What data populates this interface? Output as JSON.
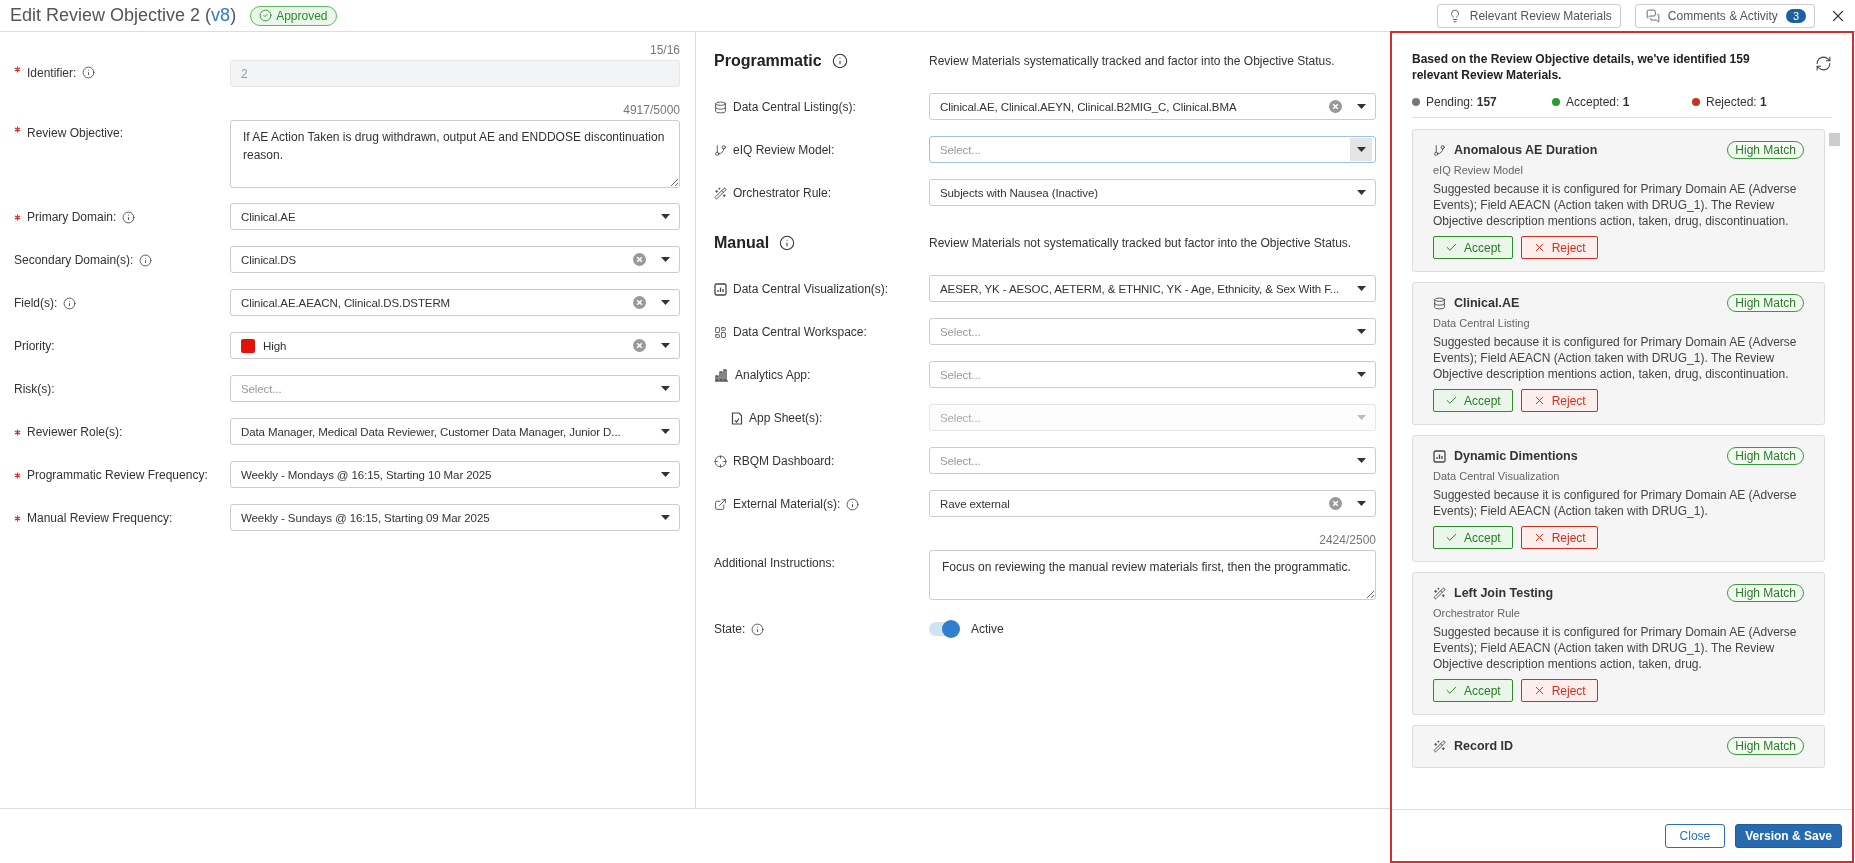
{
  "header": {
    "title": "Edit Review Objective 2",
    "version_open": "(",
    "version": "v8",
    "version_close": ")",
    "status": "Approved",
    "buttons": [
      {
        "kind": "materials",
        "label": "Relevant Review Materials"
      },
      {
        "kind": "comments",
        "label": "Comments & Activity",
        "count": "3"
      }
    ]
  },
  "left_form": {
    "fields": [
      {
        "label": "Identifier:",
        "required": true,
        "info": true,
        "kind": "input",
        "value": "2",
        "counter": "15/16",
        "disabled": true
      },
      {
        "label": "Review Objective:",
        "required": true,
        "info": false,
        "kind": "textarea",
        "value": "If AE Action Taken is drug withdrawn, output AE and ENDDOSE discontinuation reason.",
        "counter": "4917/5000",
        "disabled": false
      },
      {
        "label": "Primary Domain:",
        "required": true,
        "info": true,
        "kind": "select",
        "value": "Clinical.AE",
        "clearable": false,
        "disabled": false
      },
      {
        "label": "Secondary Domain(s):",
        "required": false,
        "info": true,
        "kind": "select",
        "value": "Clinical.DS",
        "clearable": true,
        "disabled": false
      },
      {
        "label": "Field(s):",
        "required": false,
        "info": true,
        "kind": "select",
        "value": "Clinical.AE.AEACN, Clinical.DS.DSTERM",
        "clearable": true,
        "disabled": false
      },
      {
        "label": "Priority:",
        "required": false,
        "info": false,
        "kind": "select",
        "value": "High",
        "color": "#e3120b",
        "clearable": true,
        "disabled": false
      },
      {
        "label": "Risk(s):",
        "required": false,
        "info": false,
        "kind": "select",
        "placeholder": "Select...",
        "clearable": false,
        "disabled": false
      },
      {
        "label": "Reviewer Role(s):",
        "required": true,
        "info": false,
        "kind": "select",
        "value": "Data Manager, Medical Data Reviewer, Customer Data Manager, Junior D...",
        "clearable": false,
        "disabled": false
      },
      {
        "label": "Programmatic Review Frequency:",
        "required": true,
        "info": false,
        "kind": "select",
        "value": "Weekly - Mondays @ 16:15, Starting 10 Mar 2025",
        "clearable": false,
        "disabled": false
      },
      {
        "label": "Manual Review Frequency:",
        "required": true,
        "info": false,
        "kind": "select",
        "value": "Weekly - Sundays @ 16:15, Starting 09 Mar 2025",
        "clearable": false,
        "disabled": false
      }
    ]
  },
  "middle": {
    "sections": [
      {
        "title": "Programmatic",
        "description": "Review Materials systematically tracked and factor into the Objective Status.",
        "fields": [
          {
            "label": "Data Central Listing(s):",
            "info": false,
            "kind": "select",
            "value": "Clinical.AE, Clinical.AEYN, Clinical.B2MIG_C, Clinical.BMA",
            "clearable": true,
            "disabled": false,
            "focused": false
          },
          {
            "label": "eIQ Review Model:",
            "info": false,
            "kind": "select",
            "placeholder": "Select...",
            "clearable": false,
            "disabled": false,
            "focused": true
          },
          {
            "label": "Orchestrator Rule:",
            "info": false,
            "kind": "select",
            "value": "Subjects with Nausea (Inactive)",
            "clearable": false,
            "disabled": false,
            "focused": false
          }
        ]
      },
      {
        "title": "Manual",
        "description": "Review Materials not systematically tracked but factor into the Objective Status.",
        "fields": [
          {
            "label": "Data Central Visualization(s):",
            "info": false,
            "kind": "select",
            "value": "AESER, YK - AESOC, AETERM, & ETHNIC, YK - Age, Ethnicity, & Sex With F...",
            "clearable": false,
            "disabled": false,
            "focused": false
          },
          {
            "label": "Data Central Workspace:",
            "info": false,
            "kind": "select",
            "placeholder": "Select...",
            "clearable": false,
            "disabled": false,
            "focused": false
          },
          {
            "label": "Analytics App:",
            "info": false,
            "kind": "select",
            "placeholder": "Select...",
            "clearable": false,
            "disabled": false,
            "focused": false,
            "children": [
              {
                "label": "App Sheet(s):",
                "info": false,
                "kind": "select",
                "placeholder": "Select...",
                "clearable": false,
                "disabled": true,
                "focused": false
              }
            ]
          },
          {
            "label": "RBQM Dashboard:",
            "info": false,
            "kind": "select",
            "placeholder": "Select...",
            "clearable": false,
            "disabled": false,
            "focused": false
          },
          {
            "label": "External Material(s):",
            "info": true,
            "kind": "select",
            "value": "Rave external",
            "clearable": true,
            "disabled": false,
            "focused": false
          }
        ]
      }
    ],
    "instructions": {
      "label": "Additional Instructions:",
      "counter": "2424/2500",
      "value": "Focus on reviewing the manual review materials first, then the programmatic."
    },
    "state": {
      "label": "State:",
      "info": true,
      "on": true,
      "text": "Active"
    }
  },
  "materials_panel": {
    "intro": "Based on the Review Objective details, we've identified 159 relevant Review Materials.",
    "stats": [
      {
        "text": "Pending: **157**",
        "color": "#777777"
      },
      {
        "text": "Accepted: **1**",
        "color": "#2a9d2a"
      },
      {
        "text": "Rejected: **1**",
        "color": "#c8321e"
      }
    ],
    "cards": [
      {
        "kind": "model",
        "title": "Anomalous AE Duration",
        "badge": "High Match",
        "type": "eIQ Review Model",
        "reason": "Suggested because it is configured for Primary Domain AE (Adverse Events); Field AEACN (Action taken with DRUG_1). The Review Objective description mentions action, taken, drug, discontinuation.",
        "actions": [
          {
            "kind": "accept",
            "label": "Accept"
          },
          {
            "kind": "reject",
            "label": "Reject"
          }
        ]
      },
      {
        "kind": "listing",
        "title": "Clinical.AE",
        "badge": "High Match",
        "type": "Data Central Listing",
        "reason": "Suggested because it is configured for Primary Domain AE (Adverse Events); Field AEACN (Action taken with DRUG_1). The Review Objective description mentions action, taken, drug, discontinuation.",
        "actions": [
          {
            "kind": "accept",
            "label": "Accept"
          },
          {
            "kind": "reject",
            "label": "Reject"
          }
        ]
      },
      {
        "kind": "visualization",
        "title": "Dynamic Dimentions",
        "badge": "High Match",
        "type": "Data Central Visualization",
        "reason": "Suggested because it is configured for Primary Domain AE (Adverse Events); Field AEACN (Action taken with DRUG_1).",
        "actions": [
          {
            "kind": "accept",
            "label": "Accept"
          },
          {
            "kind": "reject",
            "label": "Reject"
          }
        ]
      },
      {
        "kind": "rule",
        "title": "Left Join Testing",
        "badge": "High Match",
        "type": "Orchestrator Rule",
        "reason": "Suggested because it is configured for Primary Domain AE (Adverse Events); Field AEACN (Action taken with DRUG_1). The Review Objective description mentions action, taken, drug.",
        "actions": [
          {
            "kind": "accept",
            "label": "Accept"
          },
          {
            "kind": "reject",
            "label": "Reject"
          }
        ]
      },
      {
        "kind": "rule",
        "title": "Record ID",
        "badge": "High Match"
      }
    ],
    "buttons": [
      {
        "kind": "secondary",
        "label": "Close"
      },
      {
        "kind": "primary",
        "label": "Version & Save"
      }
    ]
  }
}
